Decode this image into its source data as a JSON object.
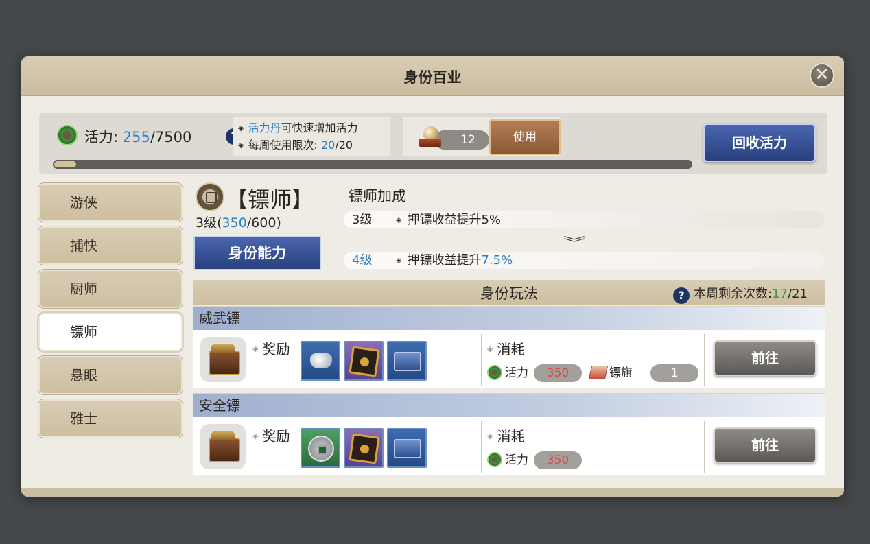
{
  "dialog": {
    "title": "身份百业",
    "close_symbol": "✕"
  },
  "vitality": {
    "label": "活力:",
    "current": "255",
    "max": "/7500",
    "fill_fraction": 0.034,
    "help": "?",
    "tip1_highlight": "活力丹",
    "tip1_text": "可快速增加活力",
    "tip2_text": "每周使用限次:",
    "tip2_current": "20",
    "tip2_max": "/20",
    "pill_count": "12",
    "use_label": "使用",
    "recycle_label": "回收活力"
  },
  "sidebar": {
    "items": [
      {
        "label": "游侠",
        "active": false
      },
      {
        "label": "捕快",
        "active": false
      },
      {
        "label": "厨师",
        "active": false
      },
      {
        "label": "镖师",
        "active": true
      },
      {
        "label": "悬眼",
        "active": false
      },
      {
        "label": "雅士",
        "active": false
      }
    ]
  },
  "identity": {
    "name": "【镖师】",
    "level_prefix": "3级(",
    "level_current": "350",
    "level_suffix": "/600)",
    "ability_label": "身份能力",
    "bonus_title": "镖师加成",
    "current_bonus": {
      "level": "3级",
      "text": "押镖收益提升5%"
    },
    "next_bonus": {
      "level": "4级",
      "text": "押镖收益提升",
      "value": "7.5%"
    }
  },
  "gameplay": {
    "title": "身份玩法",
    "remain_label": "本周剩余次数:",
    "remain_current": "17",
    "remain_max": "/21",
    "reward_label": "奖励",
    "cost_label": "消耗",
    "vitality_cost_label": "活力",
    "flag_label": "镖旗",
    "go_label": "前往",
    "cards": [
      {
        "name": "威武镖",
        "vitality_cost": "350",
        "flag_cost": "1",
        "rewards": [
          "silver-ingot-icon",
          "compass-icon",
          "treasure-box-icon"
        ]
      },
      {
        "name": "安全镖",
        "vitality_cost": "350",
        "rewards": [
          "copper-coin-icon",
          "compass-icon",
          "treasure-box-icon"
        ]
      }
    ]
  }
}
